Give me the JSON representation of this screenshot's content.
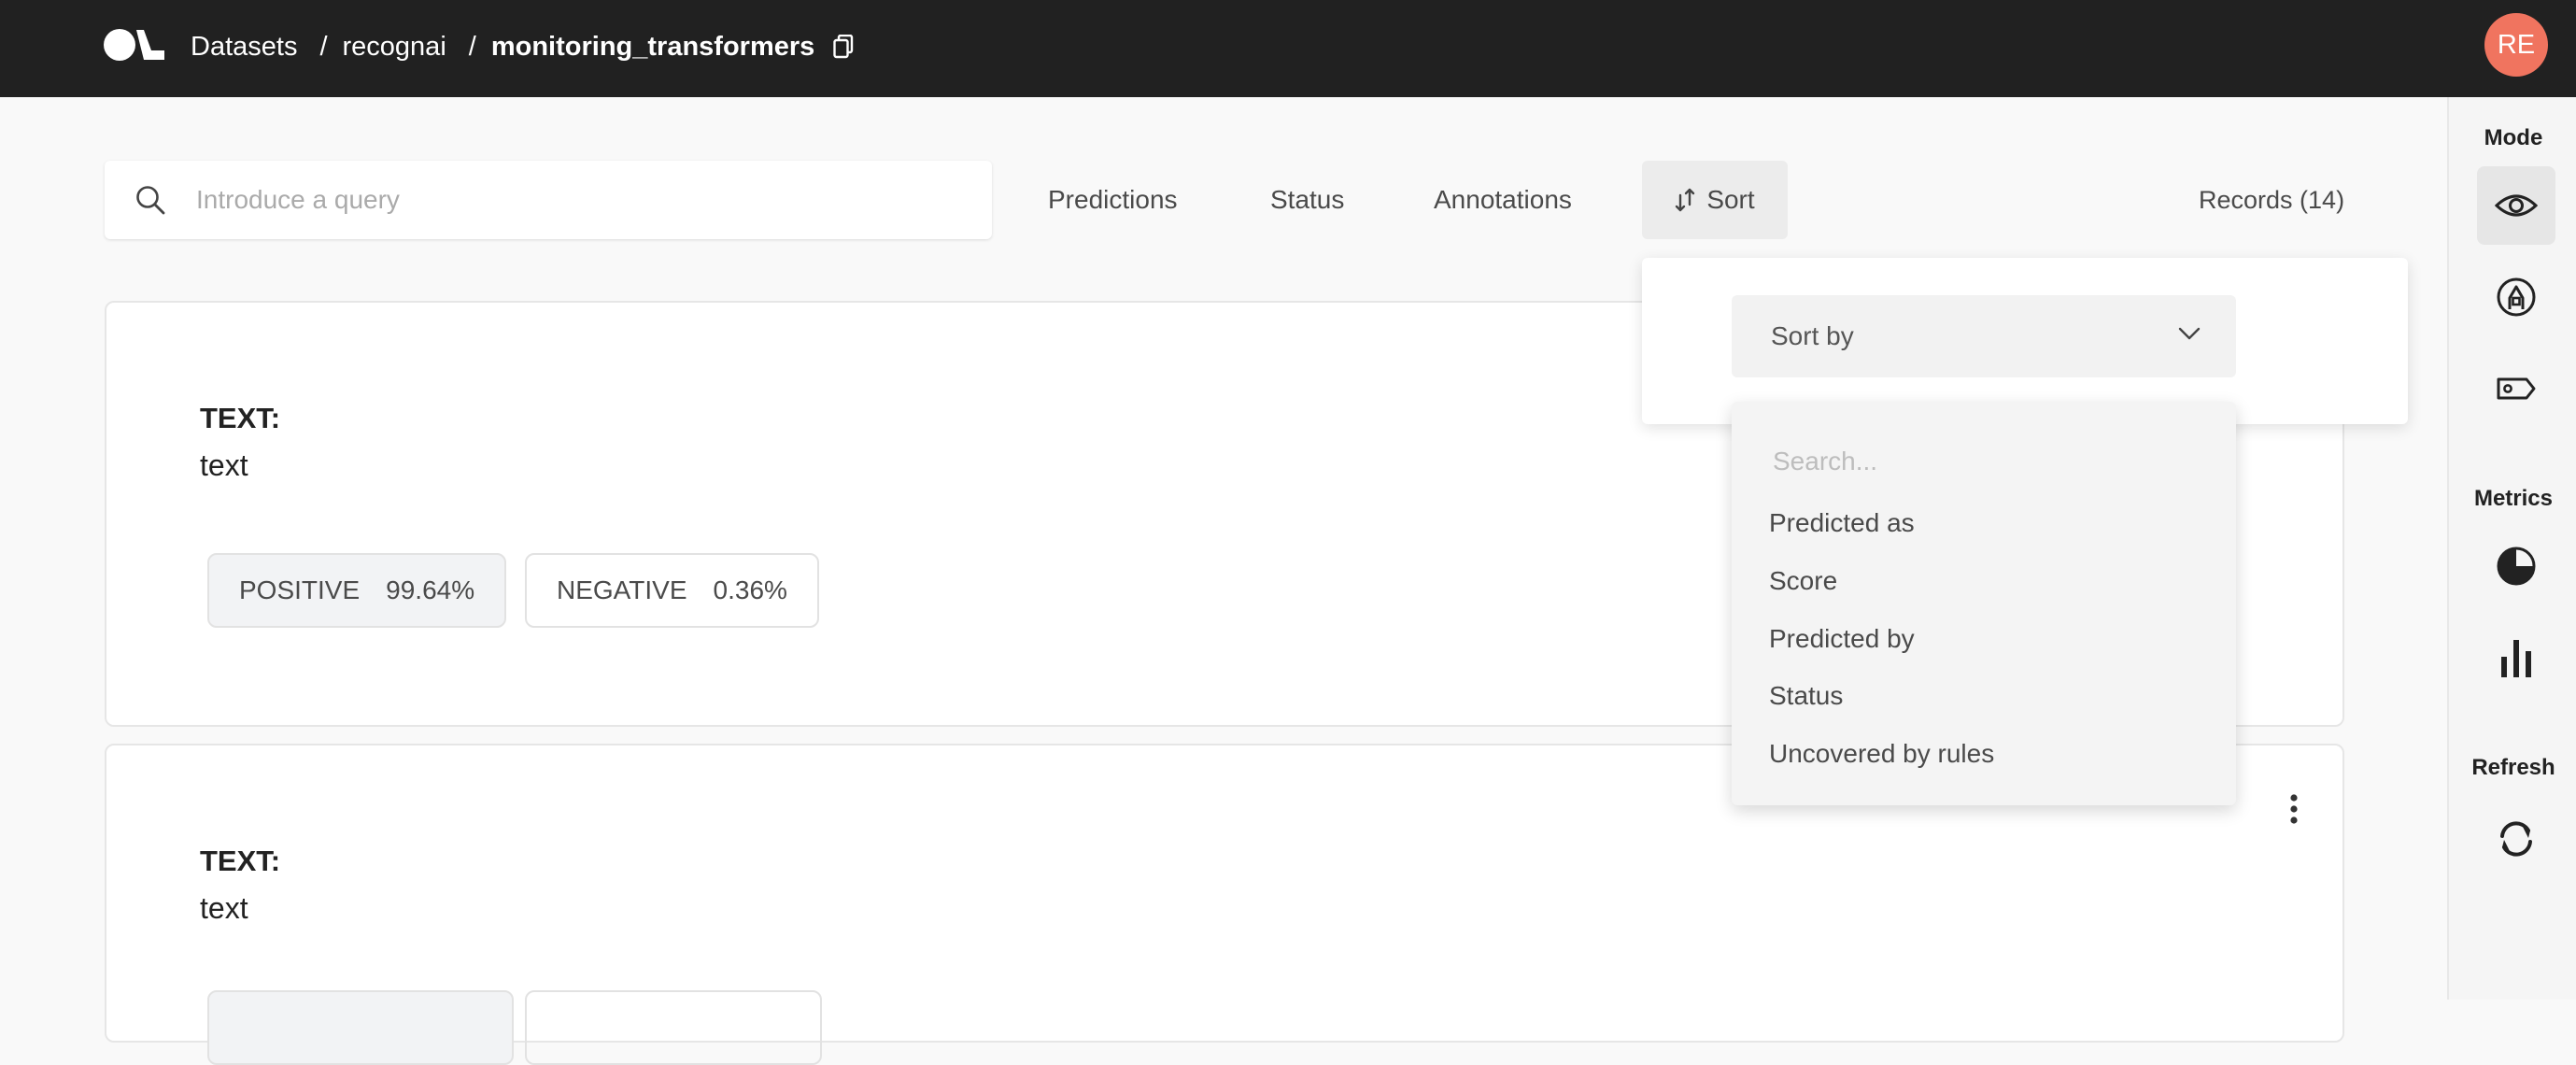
{
  "header": {
    "breadcrumbs": [
      "Datasets",
      "recognai",
      "monitoring_transformers"
    ],
    "separator": "/",
    "avatar_initials": "RE"
  },
  "search": {
    "placeholder": "Introduce a query",
    "value": ""
  },
  "filters": {
    "predictions": "Predictions",
    "status": "Status",
    "annotations": "Annotations",
    "sort": "Sort"
  },
  "records_count": "Records (14)",
  "sort_panel": {
    "select_placeholder": "Sort by",
    "search_placeholder": "Search...",
    "options": [
      "Predicted as",
      "Score",
      "Predicted by",
      "Status",
      "Uncovered by rules"
    ]
  },
  "records": [
    {
      "field_label": "TEXT:",
      "field_value": "text",
      "predictions": [
        {
          "label": "POSITIVE",
          "score": "99.64%"
        },
        {
          "label": "NEGATIVE",
          "score": "0.36%"
        }
      ]
    },
    {
      "field_label": "TEXT:",
      "field_value": "text"
    }
  ],
  "sidebar": {
    "mode_title": "Mode",
    "metrics_title": "Metrics",
    "refresh_title": "Refresh",
    "icons": [
      "eye-icon",
      "pen-icon",
      "tag-icon",
      "pie-chart-icon",
      "bar-chart-icon",
      "refresh-icon"
    ]
  },
  "colors": {
    "topbar": "#212121",
    "avatar": "#f0745f",
    "background": "#f9f9f9"
  }
}
